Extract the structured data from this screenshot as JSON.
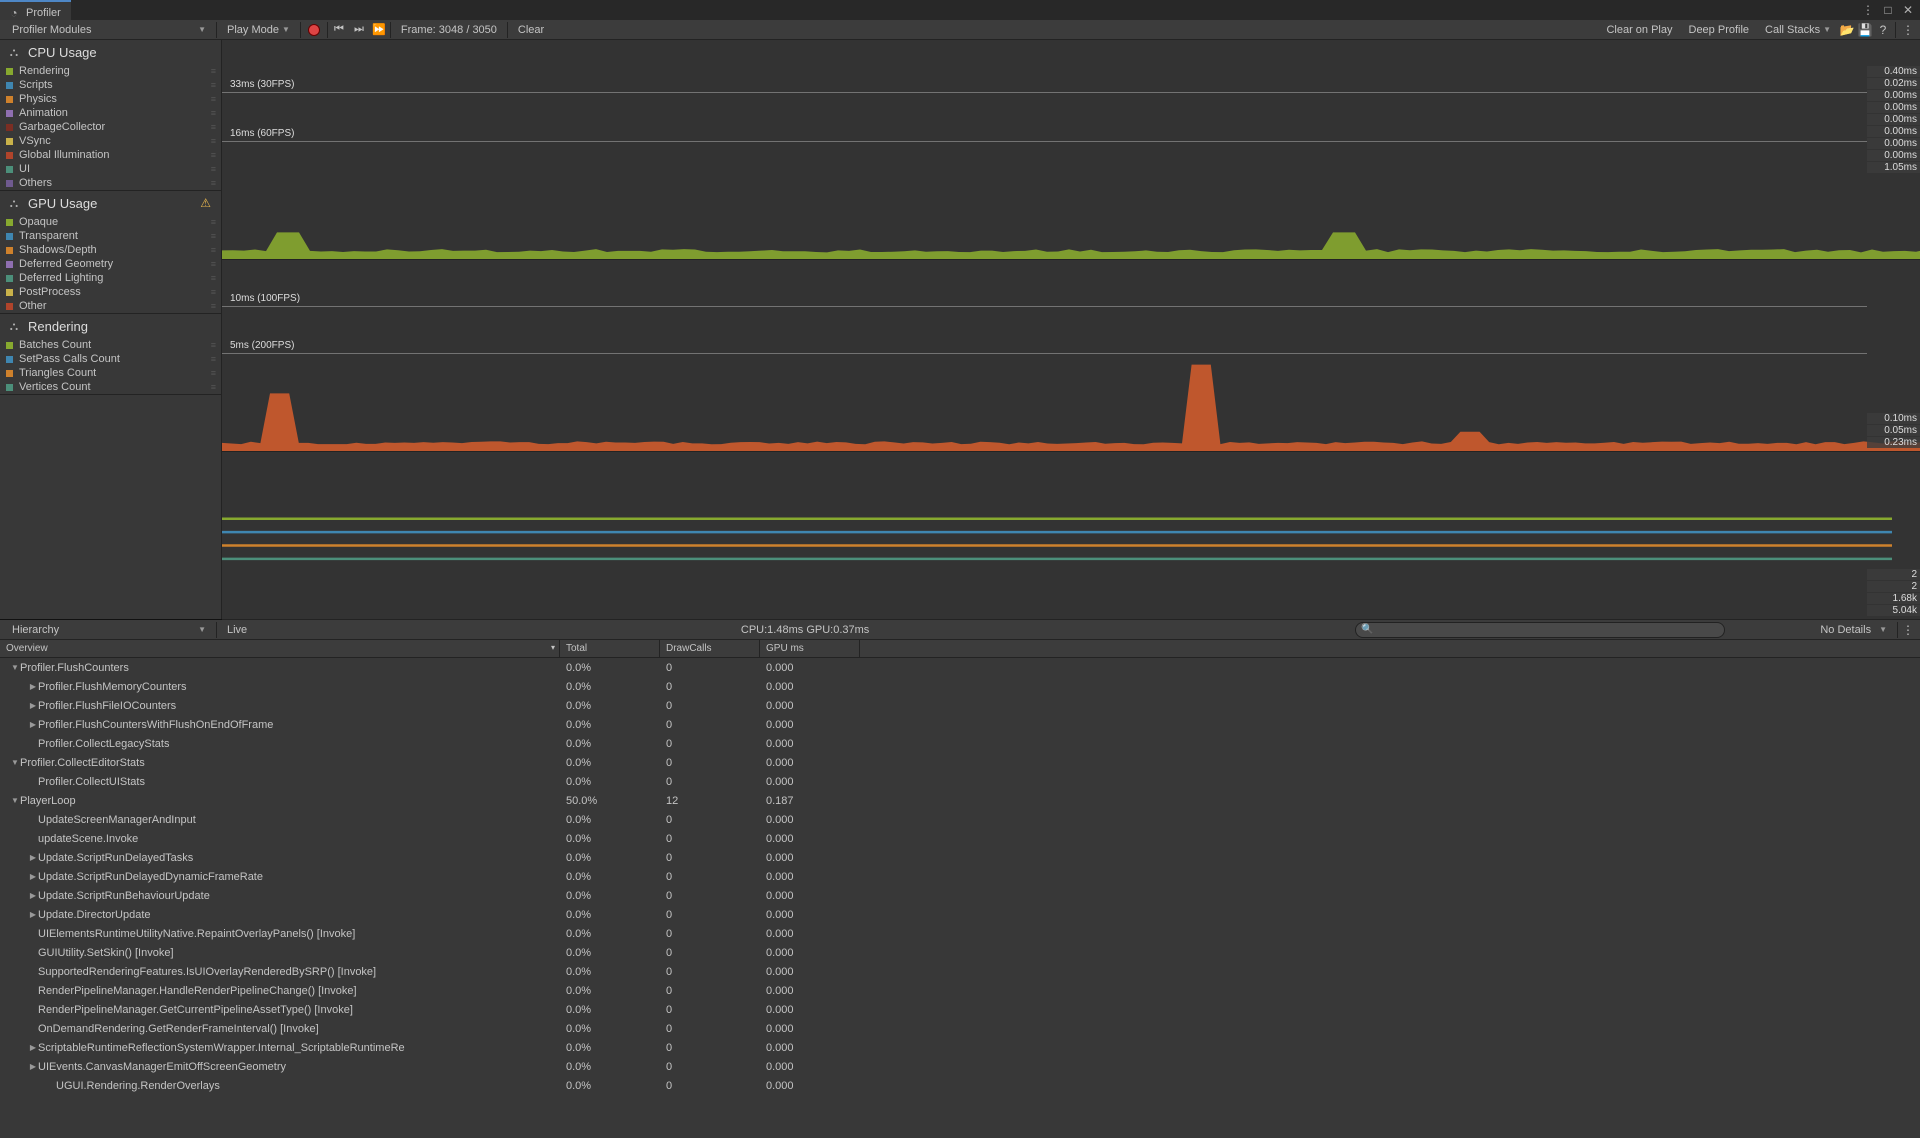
{
  "window": {
    "title": "Profiler"
  },
  "toolbar": {
    "modules_label": "Profiler Modules",
    "play_mode": "Play Mode",
    "frame_label": "Frame: 3048 / 3050",
    "clear": "Clear",
    "clear_on_play": "Clear on Play",
    "deep_profile": "Deep Profile",
    "call_stacks": "Call Stacks"
  },
  "modules": [
    {
      "name": "CPU Usage",
      "icon": "cpu",
      "warn": false,
      "ticks": [
        "0.40ms",
        "0.02ms",
        "0.00ms",
        "0.00ms",
        "0.00ms",
        "0.00ms",
        "0.00ms",
        "0.00ms",
        "1.05ms"
      ],
      "guides": [
        {
          "label": "33ms (30FPS)",
          "y": 52
        },
        {
          "label": "16ms (60FPS)",
          "y": 101
        }
      ],
      "items": [
        {
          "label": "Rendering",
          "color": "#87A92F"
        },
        {
          "label": "Scripts",
          "color": "#3F86B0"
        },
        {
          "label": "Physics",
          "color": "#CE812C"
        },
        {
          "label": "Animation",
          "color": "#8F6FB0"
        },
        {
          "label": "GarbageCollector",
          "color": "#7B2E23"
        },
        {
          "label": "VSync",
          "color": "#C9B24A"
        },
        {
          "label": "Global Illumination",
          "color": "#B0442B"
        },
        {
          "label": "UI",
          "color": "#4C8F7A"
        },
        {
          "label": "Others",
          "color": "#6F5A8F"
        }
      ]
    },
    {
      "name": "GPU Usage",
      "icon": "gpu",
      "warn": true,
      "ticks": [
        "0.10ms",
        "0.05ms",
        "0.23ms"
      ],
      "guides": [
        {
          "label": "10ms (100FPS)",
          "y": 46
        },
        {
          "label": "5ms (200FPS)",
          "y": 93
        }
      ],
      "items": [
        {
          "label": "Opaque",
          "color": "#87A92F"
        },
        {
          "label": "Transparent",
          "color": "#3F86B0"
        },
        {
          "label": "Shadows/Depth",
          "color": "#CE812C"
        },
        {
          "label": "Deferred Geometry",
          "color": "#8F6FB0"
        },
        {
          "label": "Deferred Lighting",
          "color": "#4C8F7A"
        },
        {
          "label": "PostProcess",
          "color": "#C9B24A"
        },
        {
          "label": "Other",
          "color": "#B0442B"
        }
      ]
    },
    {
      "name": "Rendering",
      "icon": "render",
      "warn": false,
      "ticks": [
        "2",
        "2",
        "1.68k",
        "5.04k"
      ],
      "guides": [],
      "items": [
        {
          "label": "Batches Count",
          "color": "#87A92F"
        },
        {
          "label": "SetPass Calls Count",
          "color": "#3F86B0"
        },
        {
          "label": "Triangles Count",
          "color": "#CE812C"
        },
        {
          "label": "Vertices Count",
          "color": "#4C8F7A"
        }
      ]
    }
  ],
  "hierarchy": {
    "view": "Hierarchy",
    "live": "Live",
    "summary": "CPU:1.48ms   GPU:0.37ms",
    "details": "No Details"
  },
  "columns": {
    "overview": "Overview",
    "total": "Total",
    "drawcalls": "DrawCalls",
    "gpums": "GPU ms"
  },
  "rows": [
    {
      "d": 0,
      "f": "open",
      "name": "Profiler.FlushCounters",
      "tot": "0.0%",
      "dc": "0",
      "g": "0.000"
    },
    {
      "d": 1,
      "f": "closed",
      "name": "Profiler.FlushMemoryCounters",
      "tot": "0.0%",
      "dc": "0",
      "g": "0.000"
    },
    {
      "d": 1,
      "f": "closed",
      "name": "Profiler.FlushFileIOCounters",
      "tot": "0.0%",
      "dc": "0",
      "g": "0.000"
    },
    {
      "d": 1,
      "f": "closed",
      "name": "Profiler.FlushCountersWithFlushOnEndOfFrame",
      "tot": "0.0%",
      "dc": "0",
      "g": "0.000"
    },
    {
      "d": 1,
      "f": "none",
      "name": "Profiler.CollectLegacyStats",
      "tot": "0.0%",
      "dc": "0",
      "g": "0.000"
    },
    {
      "d": 0,
      "f": "open",
      "name": "Profiler.CollectEditorStats",
      "tot": "0.0%",
      "dc": "0",
      "g": "0.000"
    },
    {
      "d": 1,
      "f": "none",
      "name": "Profiler.CollectUIStats",
      "tot": "0.0%",
      "dc": "0",
      "g": "0.000"
    },
    {
      "d": 0,
      "f": "open",
      "name": "PlayerLoop",
      "tot": "50.0%",
      "dc": "12",
      "g": "0.187"
    },
    {
      "d": 1,
      "f": "none",
      "name": "UpdateScreenManagerAndInput",
      "tot": "0.0%",
      "dc": "0",
      "g": "0.000"
    },
    {
      "d": 1,
      "f": "none",
      "name": "updateScene.Invoke",
      "tot": "0.0%",
      "dc": "0",
      "g": "0.000"
    },
    {
      "d": 1,
      "f": "closed",
      "name": "Update.ScriptRunDelayedTasks",
      "tot": "0.0%",
      "dc": "0",
      "g": "0.000"
    },
    {
      "d": 1,
      "f": "closed",
      "name": "Update.ScriptRunDelayedDynamicFrameRate",
      "tot": "0.0%",
      "dc": "0",
      "g": "0.000"
    },
    {
      "d": 1,
      "f": "closed",
      "name": "Update.ScriptRunBehaviourUpdate",
      "tot": "0.0%",
      "dc": "0",
      "g": "0.000"
    },
    {
      "d": 1,
      "f": "closed",
      "name": "Update.DirectorUpdate",
      "tot": "0.0%",
      "dc": "0",
      "g": "0.000"
    },
    {
      "d": 1,
      "f": "none",
      "name": "UIElementsRuntimeUtilityNative.RepaintOverlayPanels() [Invoke]",
      "tot": "0.0%",
      "dc": "0",
      "g": "0.000"
    },
    {
      "d": 1,
      "f": "none",
      "name": "GUIUtility.SetSkin() [Invoke]",
      "tot": "0.0%",
      "dc": "0",
      "g": "0.000"
    },
    {
      "d": 1,
      "f": "none",
      "name": "SupportedRenderingFeatures.IsUIOverlayRenderedBySRP() [Invoke]",
      "tot": "0.0%",
      "dc": "0",
      "g": "0.000"
    },
    {
      "d": 1,
      "f": "none",
      "name": "RenderPipelineManager.HandleRenderPipelineChange() [Invoke]",
      "tot": "0.0%",
      "dc": "0",
      "g": "0.000"
    },
    {
      "d": 1,
      "f": "none",
      "name": "RenderPipelineManager.GetCurrentPipelineAssetType() [Invoke]",
      "tot": "0.0%",
      "dc": "0",
      "g": "0.000"
    },
    {
      "d": 1,
      "f": "none",
      "name": "OnDemandRendering.GetRenderFrameInterval() [Invoke]",
      "tot": "0.0%",
      "dc": "0",
      "g": "0.000"
    },
    {
      "d": 1,
      "f": "closed",
      "name": "ScriptableRuntimeReflectionSystemWrapper.Internal_ScriptableRuntimeRe",
      "tot": "0.0%",
      "dc": "0",
      "g": "0.000"
    },
    {
      "d": 1,
      "f": "closed",
      "name": "UIEvents.CanvasManagerEmitOffScreenGeometry",
      "tot": "0.0%",
      "dc": "0",
      "g": "0.000"
    },
    {
      "d": 2,
      "f": "none",
      "name": "UGUI.Rendering.RenderOverlays",
      "tot": "0.0%",
      "dc": "0",
      "g": "0.000"
    }
  ],
  "chart_data": [
    {
      "type": "area",
      "title": "CPU Usage",
      "ylabel": "ms",
      "ylim": [
        0,
        33
      ],
      "guides": [
        {
          "label": "33ms (30FPS)",
          "y": 33
        },
        {
          "label": "16ms (60FPS)",
          "y": 16
        }
      ],
      "series": [
        {
          "name": "Rendering",
          "approx_baseline_ms": 1.0,
          "spikes": [
            {
              "x_frac": 0.03,
              "peak_ms": 4
            },
            {
              "x_frac": 0.51,
              "peak_ms": 4
            }
          ]
        }
      ],
      "right_legend_ms": [
        0.4,
        0.02,
        0.0,
        0.0,
        0.0,
        0.0,
        0.0,
        0.0,
        1.05
      ]
    },
    {
      "type": "area",
      "title": "GPU Usage",
      "ylabel": "ms",
      "ylim": [
        0,
        10
      ],
      "guides": [
        {
          "label": "10ms (100FPS)",
          "y": 10
        },
        {
          "label": "5ms (200FPS)",
          "y": 5
        }
      ],
      "series": [
        {
          "name": "Other",
          "approx_baseline_ms": 0.35,
          "spikes": [
            {
              "x_frac": 0.03,
              "peak_ms": 3
            },
            {
              "x_frac": 0.51,
              "peak_ms": 4.5
            },
            {
              "x_frac": 0.65,
              "peak_ms": 1
            }
          ]
        }
      ],
      "right_legend_ms": [
        0.1,
        0.05,
        0.23
      ]
    },
    {
      "type": "line",
      "title": "Rendering",
      "series": [
        {
          "name": "Batches Count",
          "value": 2
        },
        {
          "name": "SetPass Calls Count",
          "value": 2
        },
        {
          "name": "Triangles Count",
          "value": 1680
        },
        {
          "name": "Vertices Count",
          "value": 5040
        }
      ]
    }
  ]
}
